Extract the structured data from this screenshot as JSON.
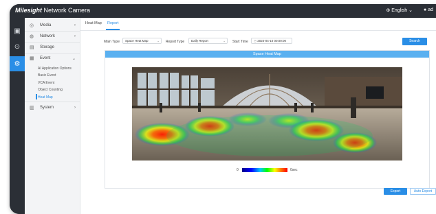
{
  "app": {
    "logo_brand": "Milesight",
    "logo_product": "Network Camera"
  },
  "topbar": {
    "language": "English",
    "language_icon": "globe-icon",
    "user_short": "ad",
    "user_icon": "user-icon"
  },
  "rail": [
    {
      "icon": "monitor-icon",
      "glyph": "▣",
      "active": false
    },
    {
      "icon": "playback-icon",
      "glyph": "⊙",
      "active": false
    },
    {
      "icon": "settings-icon",
      "glyph": "⚙",
      "active": true
    }
  ],
  "menu": {
    "items": [
      {
        "label": "Media",
        "icon": "media-icon",
        "glyph": "◎"
      },
      {
        "label": "Network",
        "icon": "network-icon",
        "glyph": "◍"
      },
      {
        "label": "Storage",
        "icon": "storage-icon",
        "glyph": "▤"
      },
      {
        "label": "Event",
        "icon": "event-icon",
        "glyph": "▦"
      },
      {
        "label": "System",
        "icon": "system-icon",
        "glyph": "▥"
      }
    ],
    "event_sub": [
      "AI Application Options",
      "Basic Event",
      "VCA Event",
      "Object Counting",
      "Heat Map"
    ]
  },
  "tabs": {
    "heat_map": "Heat Map",
    "report": "Report"
  },
  "form": {
    "main_type_label": "Main Type",
    "main_type_value": "Space Heat Map",
    "report_type_label": "Report Type",
    "report_type_value": "Daily Report",
    "start_time_label": "Start Time",
    "start_time_value": "2024-04-10 00:00:00",
    "search_button": "Search"
  },
  "panel": {
    "title": "Space Heat Map",
    "legend_min": "0",
    "legend_max": "0sec"
  },
  "actions": {
    "export": "Export",
    "auto_export": "Auto Export"
  }
}
